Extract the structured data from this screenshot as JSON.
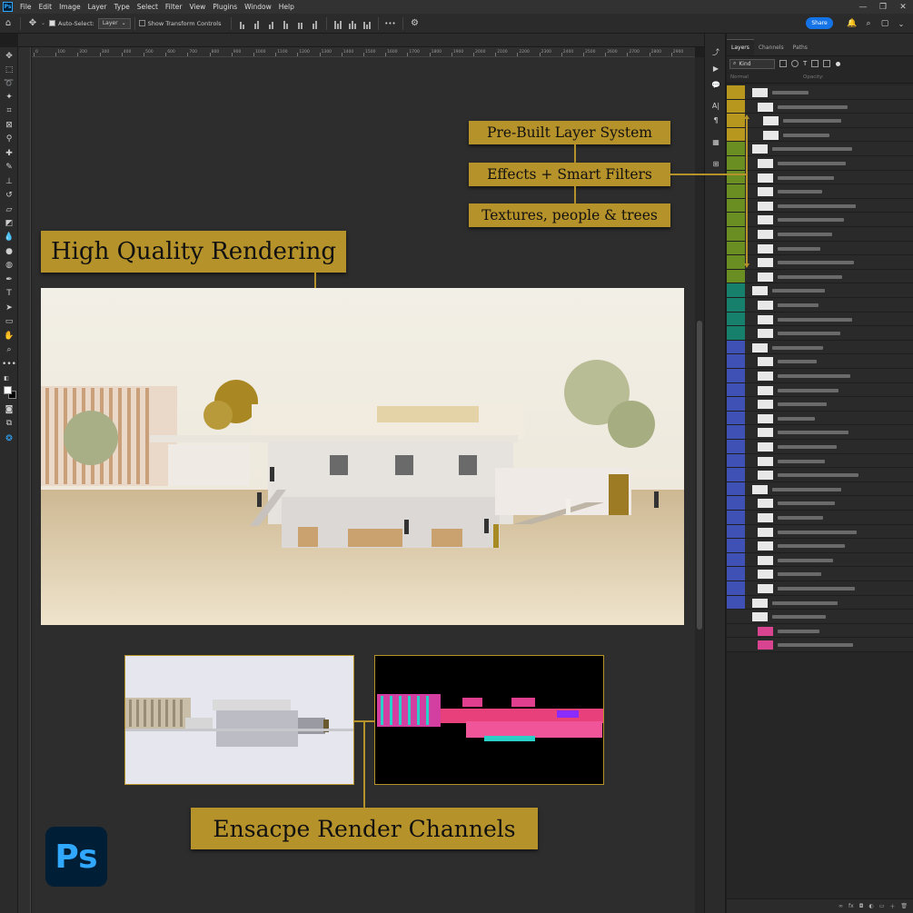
{
  "app": {
    "logo_text": "Ps",
    "badge_text": "Ps"
  },
  "menu": [
    "File",
    "Edit",
    "Image",
    "Layer",
    "Type",
    "Select",
    "Filter",
    "View",
    "Plugins",
    "Window",
    "Help"
  ],
  "window_controls": [
    "—",
    "❐",
    "✕"
  ],
  "options_bar": {
    "auto_select_label": "Auto-Select:",
    "auto_select_value": "Layer",
    "transform_label": "Show Transform Controls",
    "more_label": "•••",
    "share_label": "Share"
  },
  "ruler_ticks": [
    "0",
    "100",
    "200",
    "300",
    "400",
    "500",
    "600",
    "700",
    "800",
    "900",
    "1000",
    "1100",
    "1200",
    "1300",
    "1400",
    "1500",
    "1600",
    "1700",
    "1800",
    "1900",
    "2000",
    "2100",
    "2200",
    "2300",
    "2400",
    "2500",
    "2600",
    "2700",
    "2800",
    "2900"
  ],
  "labels": {
    "prebuilt": "Pre-Built Layer System",
    "effects": "Effects + Smart Filters",
    "textures": "Textures, people & trees",
    "hq": "High Quality Rendering",
    "channels": "Ensacpe Render Channels"
  },
  "layers_panel": {
    "tabs": [
      "Layers",
      "Channels",
      "Paths"
    ],
    "active_tab": "Layers",
    "kind_label": "Kind",
    "blend_mode": "Normal",
    "opacity_label": "Opacity:",
    "bottom_icons": [
      "∞",
      "fx",
      "◘",
      "◐",
      "▭",
      "＋",
      "🗑"
    ],
    "layer_colors": [
      "#b8971f",
      "#b8971f",
      "#b8971f",
      "#b8971f",
      "#6b8e23",
      "#6b8e23",
      "#6b8e23",
      "#6b8e23",
      "#6b8e23",
      "#6b8e23",
      "#6b8e23",
      "#6b8e23",
      "#6b8e23",
      "#6b8e23",
      "#17806d",
      "#17806d",
      "#17806d",
      "#17806d",
      "#3f51b5",
      "#3f51b5",
      "#3f51b5",
      "#3f51b5",
      "#3f51b5",
      "#3f51b5",
      "#3f51b5",
      "#3f51b5",
      "#3f51b5",
      "#3f51b5",
      "#3f51b5",
      "#3f51b5",
      "#3f51b5",
      "#3f51b5",
      "#3f51b5",
      "#3f51b5",
      "#3f51b5",
      "#3f51b5",
      "#3f51b5",
      "#2a2a2a",
      "#2a2a2a",
      "#2a2a2a"
    ]
  },
  "colors": {
    "accent_gold": "#b6922a",
    "share_blue": "#1473e6",
    "ps_blue": "#31a8ff",
    "ps_navy": "#001e36"
  }
}
